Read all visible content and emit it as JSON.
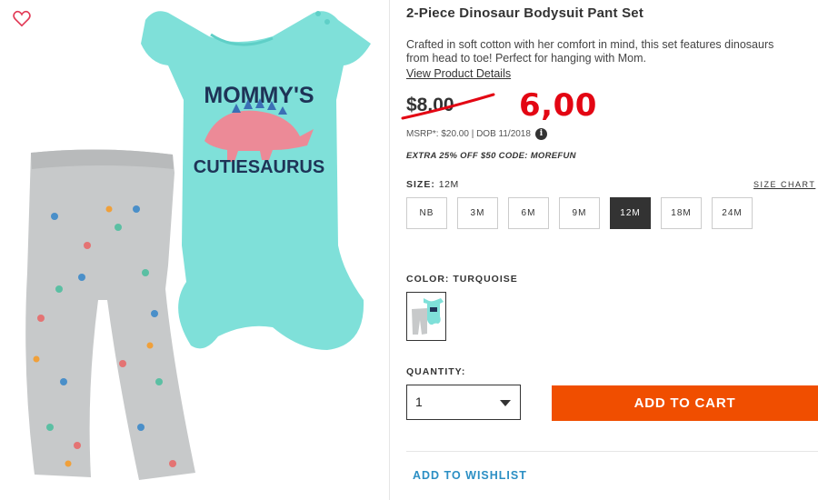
{
  "product": {
    "title": "2-Piece Dinosaur Bodysuit Pant Set",
    "description": "Crafted in soft cotton with her comfort in mind, this set features dinosaurs from head to toe! Perfect for hanging with Mom.",
    "view_details_link": "View Product Details",
    "image_graphic_text": [
      "MOMMY'S",
      "CUTIESAURUS"
    ]
  },
  "pricing": {
    "old_price": "$8.00",
    "new_price": "6,00",
    "msrp_text": "MSRP*: $20.00 | DOB 11/2018",
    "info_icon": "info-icon",
    "promo_text": "EXTRA 25% OFF $50 CODE: MOREFUN"
  },
  "size": {
    "label": "SIZE:",
    "selected": "12M",
    "chart_link": "SIZE CHART",
    "options": [
      "NB",
      "3M",
      "6M",
      "9M",
      "12M",
      "18M",
      "24M"
    ]
  },
  "color": {
    "label": "COLOR: TURQUOISE"
  },
  "quantity": {
    "label": "QUANTITY:",
    "value": "1"
  },
  "actions": {
    "add_to_cart": "ADD TO CART",
    "add_to_wishlist": "ADD TO WISHLIST"
  },
  "colors": {
    "accent_orange": "#f04e00",
    "price_red": "#e30613",
    "wishlist_blue": "#2c8fc4",
    "bodysuit_turquoise": "#7fe0d9",
    "selected_size_bg": "#333333"
  }
}
